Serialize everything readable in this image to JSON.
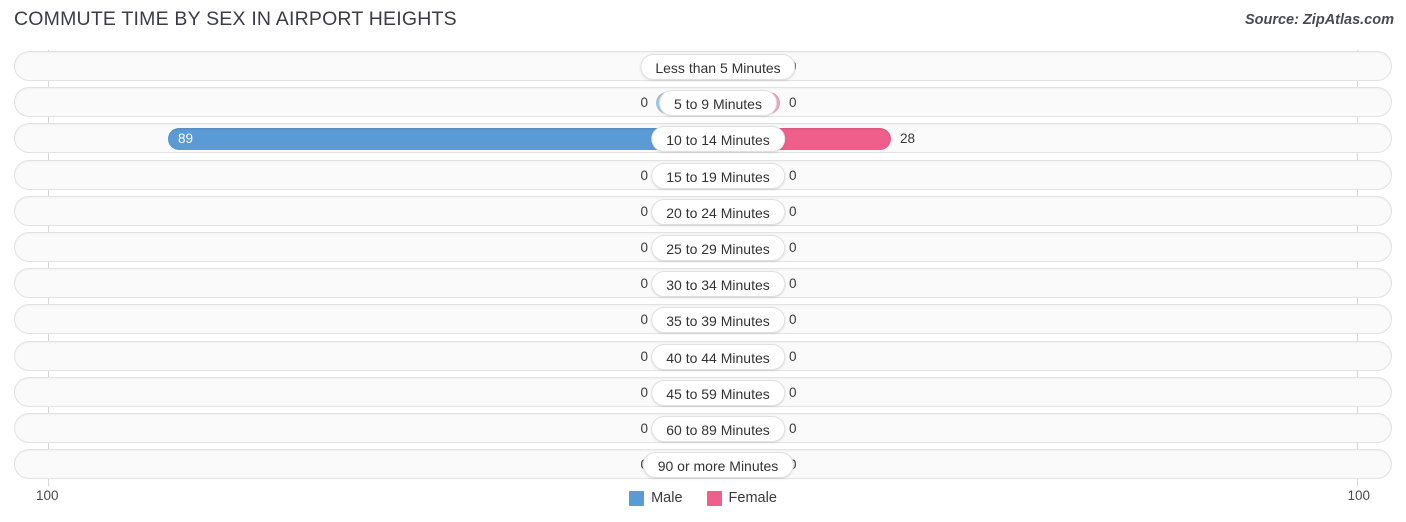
{
  "header": {
    "title": "COMMUTE TIME BY SEX IN AIRPORT HEIGHTS",
    "source": "Source: ZipAtlas.com"
  },
  "axis": {
    "left_tick": "100",
    "right_tick": "100"
  },
  "legend": {
    "items": [
      {
        "label": "Male",
        "color": "#5b9bd5"
      },
      {
        "label": "Female",
        "color": "#ef5f8c"
      }
    ]
  },
  "colors": {
    "male": "#5b9bd5",
    "female": "#ef5f8c",
    "male_zero": "#a9c8ea",
    "female_zero": "#f7a5c2",
    "track_bg": "#fafafa",
    "track_border": "#e2e2e2",
    "gridline": "#d6d6d6"
  },
  "chart_data": {
    "type": "bar",
    "title": "COMMUTE TIME BY SEX IN AIRPORT HEIGHTS",
    "subtitle": "",
    "orientation": "horizontal-diverging",
    "xlabel": "",
    "ylabel": "",
    "xlim": [
      100,
      100
    ],
    "axis_max": 100,
    "grid": true,
    "legend_position": "bottom-center",
    "categories": [
      "Less than 5 Minutes",
      "5 to 9 Minutes",
      "10 to 14 Minutes",
      "15 to 19 Minutes",
      "20 to 24 Minutes",
      "25 to 29 Minutes",
      "30 to 34 Minutes",
      "35 to 39 Minutes",
      "40 to 44 Minutes",
      "45 to 59 Minutes",
      "60 to 89 Minutes",
      "90 or more Minutes"
    ],
    "series": [
      {
        "name": "Male",
        "color": "#5b9bd5",
        "values": [
          0,
          0,
          89,
          0,
          0,
          0,
          0,
          0,
          0,
          0,
          0,
          0
        ],
        "labels": [
          "0",
          "0",
          "89",
          "0",
          "0",
          "0",
          "0",
          "0",
          "0",
          "0",
          "0",
          "0"
        ]
      },
      {
        "name": "Female",
        "color": "#ef5f8c",
        "values": [
          0,
          0,
          28,
          0,
          0,
          0,
          0,
          0,
          0,
          0,
          0,
          0
        ],
        "labels": [
          "0",
          "0",
          "28",
          "0",
          "0",
          "0",
          "0",
          "0",
          "0",
          "0",
          "0",
          "0"
        ]
      }
    ]
  }
}
